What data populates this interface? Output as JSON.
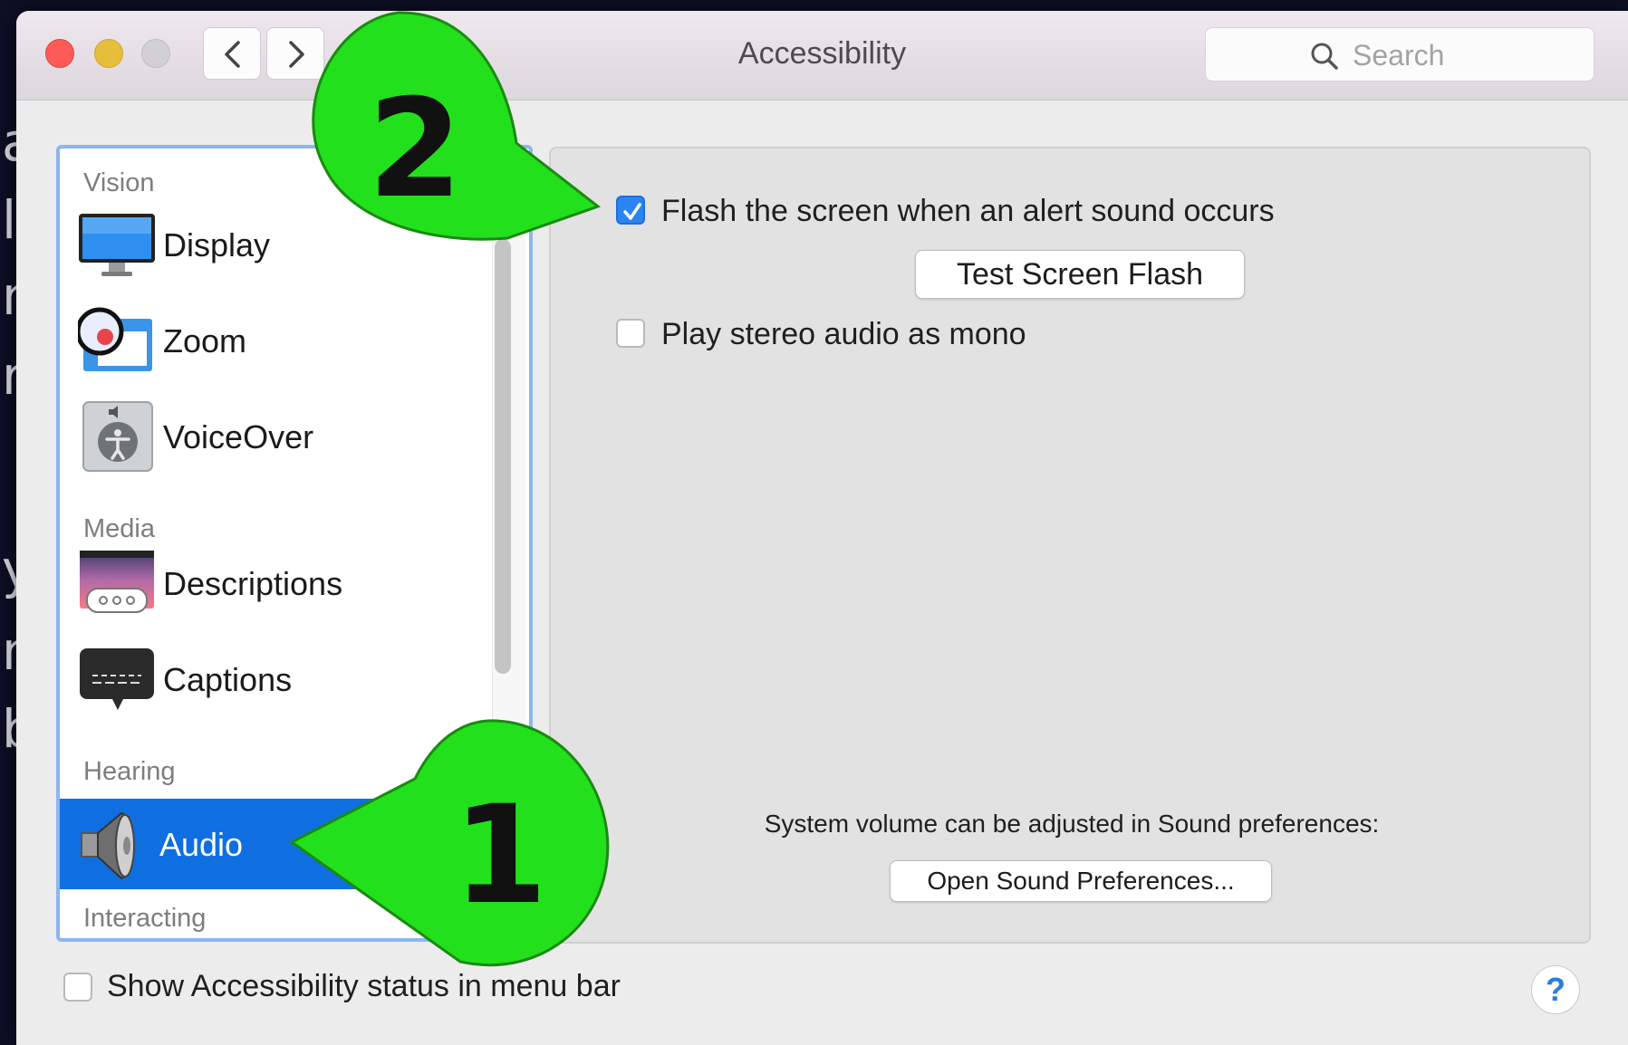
{
  "background": {
    "fragments": [
      "a",
      "l",
      "n",
      "r",
      "y",
      "na",
      "b"
    ]
  },
  "window": {
    "title": "Accessibility",
    "search_placeholder": "Search"
  },
  "sidebar": {
    "sections": [
      {
        "label": "Vision"
      },
      {
        "label": "Media"
      },
      {
        "label": "Hearing"
      },
      {
        "label": "Interacting"
      }
    ],
    "items": [
      {
        "label": "Display",
        "icon": "display-icon"
      },
      {
        "label": "Zoom",
        "icon": "zoom-icon"
      },
      {
        "label": "VoiceOver",
        "icon": "voiceover-icon"
      },
      {
        "label": "Descriptions",
        "icon": "descriptions-icon"
      },
      {
        "label": "Captions",
        "icon": "captions-icon"
      },
      {
        "label": "Audio",
        "icon": "speaker-icon",
        "selected": true
      }
    ]
  },
  "audio": {
    "flash_screen": {
      "label": "Flash the screen when an alert sound occurs",
      "checked": true
    },
    "test_flash_button": "Test Screen Flash",
    "stereo_mono": {
      "label": "Play stereo audio as mono",
      "checked": false
    },
    "volume_note": "System volume can be adjusted in Sound preferences:",
    "open_sound_button": "Open Sound Preferences..."
  },
  "footer": {
    "status_menu": {
      "label": "Show Accessibility status in menu bar",
      "checked": false
    },
    "help": "?"
  },
  "callouts": [
    {
      "number": "1",
      "color": "#22e01c"
    },
    {
      "number": "2",
      "color": "#22e01c"
    }
  ],
  "colors": {
    "selection": "#0f6fe0",
    "checkbox_checked": "#2c84f2",
    "sidebar_border": "#8cb6ee"
  }
}
